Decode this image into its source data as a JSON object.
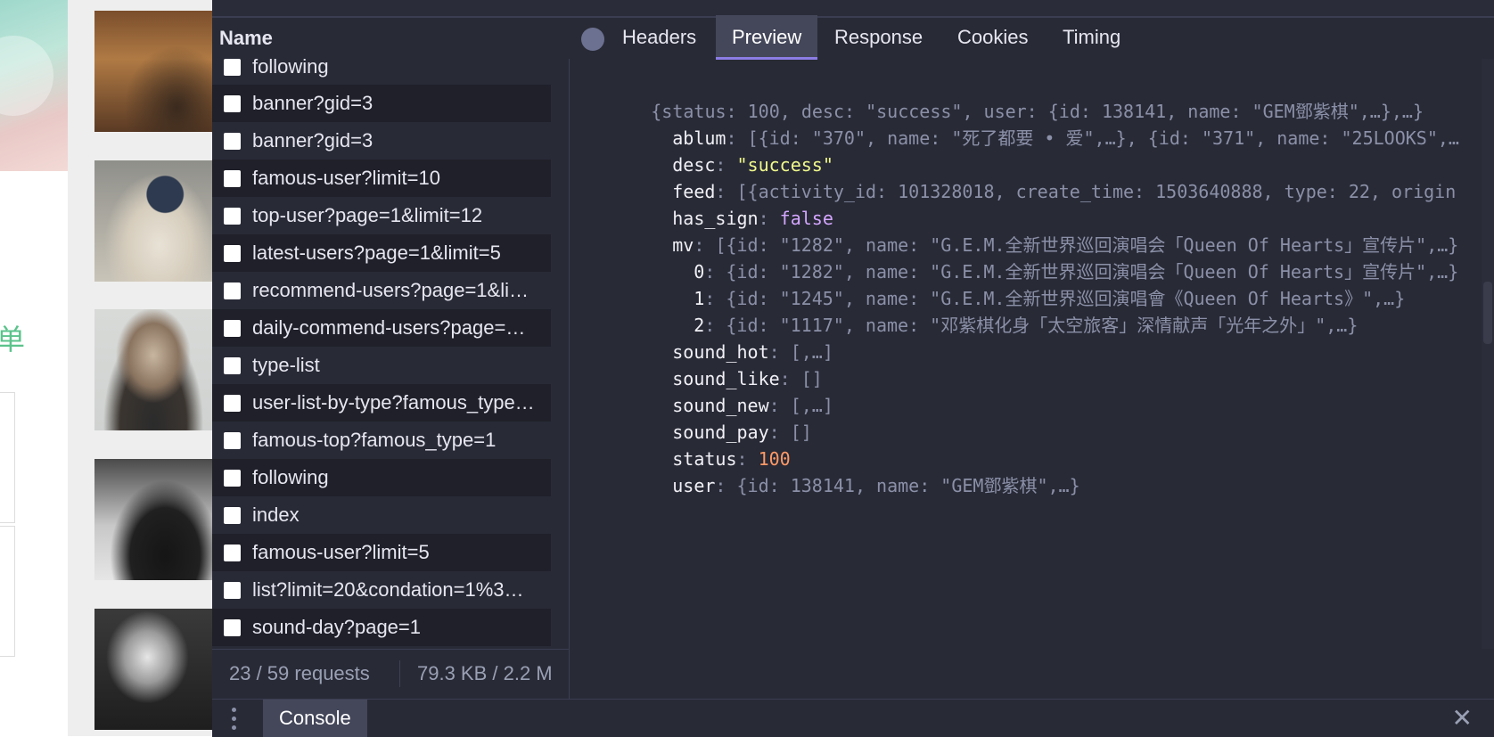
{
  "webpage": {
    "partial_char": "单"
  },
  "devtools": {
    "name_header": "Name",
    "requests": [
      {
        "name": "following"
      },
      {
        "name": "banner?gid=3"
      },
      {
        "name": "banner?gid=3"
      },
      {
        "name": "famous-user?limit=10"
      },
      {
        "name": "top-user?page=1&limit=12"
      },
      {
        "name": "latest-users?page=1&limit=5"
      },
      {
        "name": "recommend-users?page=1&li…"
      },
      {
        "name": "daily-commend-users?page=…"
      },
      {
        "name": "type-list"
      },
      {
        "name": "user-list-by-type?famous_type…"
      },
      {
        "name": "famous-top?famous_type=1"
      },
      {
        "name": "following"
      },
      {
        "name": "index"
      },
      {
        "name": "famous-user?limit=5"
      },
      {
        "name": "list?limit=20&condation=1%3…"
      },
      {
        "name": "sound-day?page=1"
      }
    ],
    "summary": {
      "requests": "23 / 59 requests",
      "transfer": "79.3 KB / 2.2 M"
    },
    "tabs": {
      "headers": "Headers",
      "preview": "Preview",
      "response": "Response",
      "cookies": "Cookies",
      "timing": "Timing",
      "active": "Preview"
    },
    "preview": {
      "root_summary": "{status: 100, desc: \"success\", user: {id: 138141, name: \"GEM鄧紫棋\",…},…}",
      "ablum_key": "ablum",
      "ablum_value": "[{id: \"370\", name: \"死了都要 • 爱\",…}, {id: \"371\", name: \"25LOOKS\",…",
      "desc_key": "desc",
      "desc_value": "\"success\"",
      "feed_key": "feed",
      "feed_value": "[{activity_id: 101328018, create_time: 1503640888, type: 22, origin",
      "has_sign_key": "has_sign",
      "has_sign_value": "false",
      "mv_key": "mv",
      "mv_value": "[{id: \"1282\", name: \"G.E.M.全新世界巡回演唱会「Queen Of Hearts」宣传片\",…}",
      "mv_items": [
        {
          "index": "0",
          "value": "{id: \"1282\", name: \"G.E.M.全新世界巡回演唱会「Queen Of Hearts」宣传片\",…}"
        },
        {
          "index": "1",
          "value": "{id: \"1245\", name: \"G.E.M.全新世界巡回演唱會《Queen Of Hearts》\",…}"
        },
        {
          "index": "2",
          "value": "{id: \"1117\", name: \"邓紫棋化身「太空旅客」深情献声「光年之外」\",…}"
        }
      ],
      "sound_hot_key": "sound_hot",
      "sound_hot_value": "[,…]",
      "sound_like_key": "sound_like",
      "sound_like_value": "[]",
      "sound_new_key": "sound_new",
      "sound_new_value": "[,…]",
      "sound_pay_key": "sound_pay",
      "sound_pay_value": "[]",
      "status_key": "status",
      "status_value": "100",
      "user_key": "user",
      "user_value": "{id: 138141, name: \"GEM鄧紫棋\",…}",
      "colors": {
        "key": "#f0f0f6",
        "muted": "#8b90a8",
        "string": "#f1fa8c",
        "boolean": "#d4a6ff",
        "number": "#ff9966"
      }
    },
    "drawer": {
      "console_tab": "Console",
      "menu_icon": "more-vertical-icon",
      "close_icon": "close-icon",
      "close_glyph": "✕"
    },
    "accent_color": "#8b7ce5",
    "background_color": "#282a36"
  }
}
